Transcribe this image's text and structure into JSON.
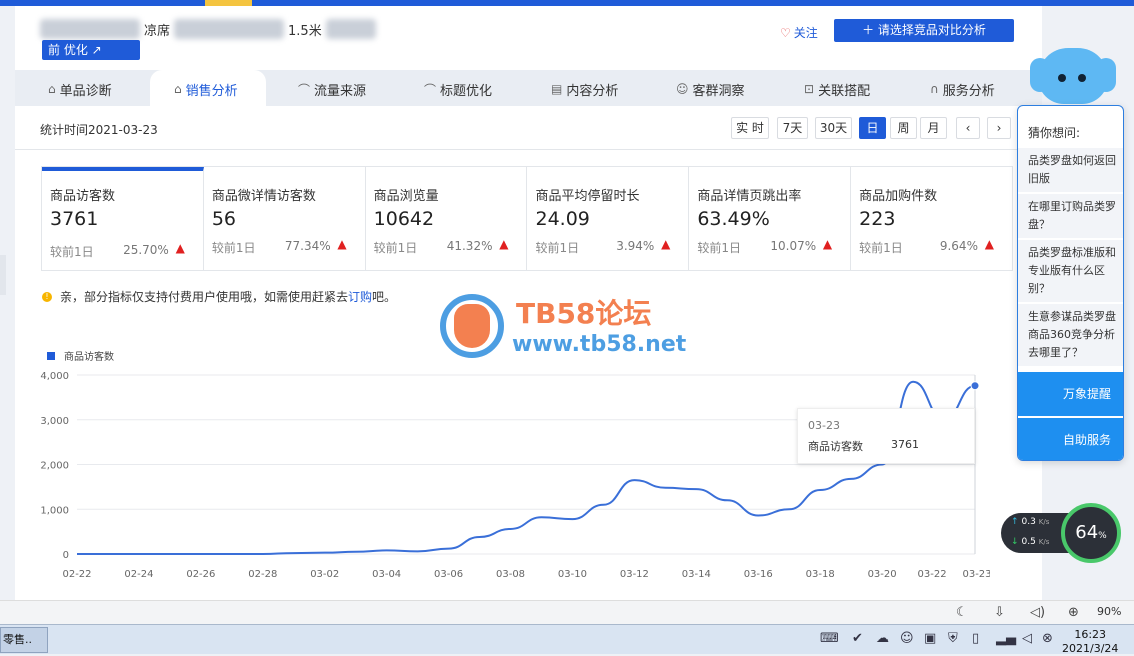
{
  "product": {
    "title_visible": "凉席",
    "title_suffix": "1.5米",
    "tag_label": "前 优化 ↗"
  },
  "header": {
    "follow_label": "关注",
    "compare_label": "＋ 请选择竞品对比分析"
  },
  "tabs": [
    {
      "label": "单品诊断",
      "icon": "shop-icon",
      "glyph": "⌂"
    },
    {
      "label": "销售分析",
      "icon": "shop-icon",
      "glyph": "⌂",
      "active": true
    },
    {
      "label": "流量来源",
      "icon": "trend-icon",
      "glyph": "⌒"
    },
    {
      "label": "标题优化",
      "icon": "trend-icon",
      "glyph": "⌒"
    },
    {
      "label": "内容分析",
      "icon": "doc-icon",
      "glyph": "▤"
    },
    {
      "label": "客群洞察",
      "icon": "people-icon",
      "glyph": "☺"
    },
    {
      "label": "关联搭配",
      "icon": "link-icon",
      "glyph": "⊡"
    },
    {
      "label": "服务分析",
      "icon": "headset-icon",
      "glyph": "∩"
    }
  ],
  "date": {
    "stat_time": "统计时间2021-03-23",
    "ranges": [
      "实 时",
      "7天",
      "30天",
      "日",
      "周",
      "月"
    ],
    "selected": "日",
    "prev": "‹",
    "next": "›"
  },
  "metrics": [
    {
      "label": "商品访客数",
      "value": "3761",
      "compare": "较前1日",
      "pct": "25.70%",
      "arrow": "▲",
      "active": true
    },
    {
      "label": "商品微详情访客数",
      "value": "56",
      "compare": "较前1日",
      "pct": "77.34%",
      "arrow": "▲"
    },
    {
      "label": "商品浏览量",
      "value": "10642",
      "compare": "较前1日",
      "pct": "41.32%",
      "arrow": "▲"
    },
    {
      "label": "商品平均停留时长",
      "value": "24.09",
      "compare": "较前1日",
      "pct": "3.94%",
      "arrow": "▲"
    },
    {
      "label": "商品详情页跳出率",
      "value": "63.49%",
      "compare": "较前1日",
      "pct": "10.07%",
      "arrow": "▲"
    },
    {
      "label": "商品加购件数",
      "value": "223",
      "compare": "较前1日",
      "pct": "9.64%",
      "arrow": "▲"
    }
  ],
  "notice": {
    "icon": "info-icon",
    "text": "亲，部分指标仅支持付费用户使用哦，如需使用赶紧去 ",
    "link": "订购",
    "suffix": "吧。"
  },
  "watermark": {
    "title": "TB58论坛",
    "url": "www.tb58.net"
  },
  "tooltip": {
    "date": "03-23",
    "label": "商品访客数",
    "value": "3761"
  },
  "chart_data": {
    "type": "line",
    "series": [
      {
        "name": "商品访客数",
        "color": "#3a6fd8"
      }
    ],
    "x": [
      "02-22",
      "02-23",
      "02-24",
      "02-25",
      "02-26",
      "02-27",
      "02-28",
      "03-01",
      "03-02",
      "03-03",
      "03-04",
      "03-05",
      "03-06",
      "03-07",
      "03-08",
      "03-09",
      "03-10",
      "03-11",
      "03-12",
      "03-13",
      "03-14",
      "03-15",
      "03-16",
      "03-17",
      "03-18",
      "03-19",
      "03-20",
      "03-21",
      "03-22",
      "03-23"
    ],
    "y": [
      0,
      0,
      0,
      0,
      0,
      0,
      0,
      20,
      30,
      50,
      80,
      60,
      120,
      380,
      560,
      820,
      780,
      1100,
      1650,
      1480,
      1450,
      1200,
      860,
      1000,
      1430,
      1680,
      2000,
      3850,
      3000,
      3761
    ],
    "xticks": [
      "02-22",
      "02-24",
      "02-26",
      "02-28",
      "03-02",
      "03-04",
      "03-06",
      "03-08",
      "03-10",
      "03-12",
      "03-14",
      "03-16",
      "03-18",
      "03-20",
      "03-22",
      "03-23"
    ],
    "yticks": [
      "0",
      "1,000",
      "2,000",
      "3,000",
      "4,000"
    ],
    "ylim": [
      0,
      4000
    ]
  },
  "assistant": {
    "header": "猜你想问:",
    "questions": [
      "品类罗盘如何返回旧版",
      "在哪里订购品类罗盘？",
      "品类罗盘标准版和专业版有什么区别？",
      "生意参谋品类罗盘商品360竞争分析去哪里了？"
    ],
    "btn1": "万象提醒",
    "btn2": "自助服务"
  },
  "network": {
    "up": "0.3",
    "down": "0.5",
    "unit": "K/s",
    "cpu": "64",
    "pct": "%"
  },
  "browser": {
    "zoom": "90%"
  },
  "taskbar": {
    "item": "零售..",
    "time": "16:23",
    "date": "2021/3/24"
  }
}
